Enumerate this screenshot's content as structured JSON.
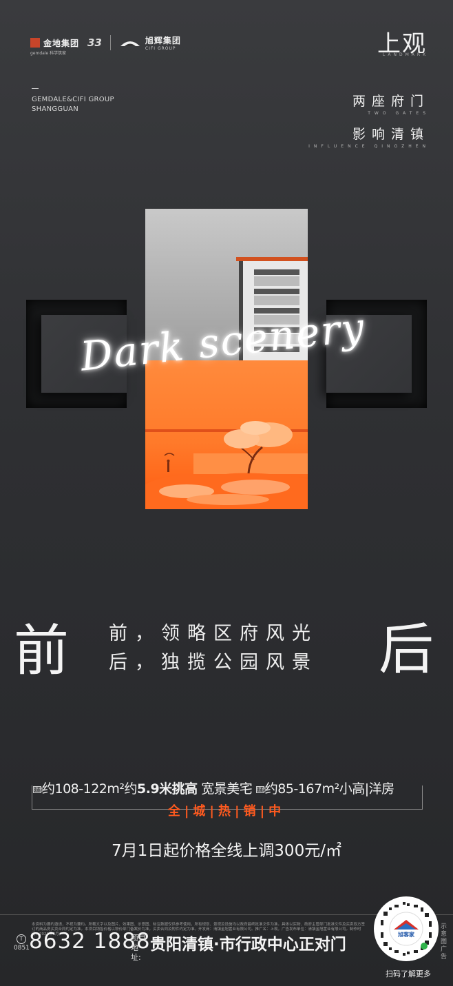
{
  "header": {
    "gemdale_logo": "金地集团",
    "gemdale_sub": "gemdale 科学筑家",
    "anniversary": "33",
    "cifi_logo": "旭辉集团",
    "cifi_sub": "CIFI GROUP",
    "brand_cn": "上观",
    "brand_en": "LANDMARK",
    "group_en_1": "GEMDALE&CIFI GROUP",
    "group_en_2": "SHANGGUAN",
    "slogan_1_cn": "两座府门",
    "slogan_1_en": "TWO GATES",
    "slogan_2_cn": "影响清镇",
    "slogan_2_en": "INFLUENCE QINGZHEN"
  },
  "hero": {
    "script_text": "Dark scenery"
  },
  "headline": {
    "left_char": "前",
    "right_char": "后",
    "line_1": "前，领略区府风光",
    "line_2": "后，独揽公园风景"
  },
  "promo": {
    "chip_label": "建面",
    "area_1": "约108-122m²约",
    "highlight": "5.9米挑高",
    "desc_1": "宽景美宅",
    "area_2": "约85-167m²小高|洋房",
    "hot_sale": "全|城|热|销|中",
    "price_note": "7月1日起价格全线上调300元/㎡"
  },
  "footer": {
    "phone_icon_label": "T",
    "area_code": "0851",
    "phone": "8632 1888",
    "addr_label": "项目地址:",
    "address": "贵阳清镇·市行政中心正对门",
    "fine_print": "本资料为要约邀请，不视为要约。所载文字以及图片、效果图、示意图、标注数据仅供参考使用，所有规划、景观及设施均以政府最终批准文件为准。具体以实物、政府主管部门批准文件及买卖双方签订的商品房买卖合同约定为准。本项目销售价格以物价部门备案价为准，买卖合同及附件约定为准。开发商：清镇金旭置业有限公司。推广名：上观。广告发布单位：清镇金旭置业有限公司。制作时间：2021年6月。",
    "qr_brand": "旭客家",
    "qr_caption": "扫码了解更多",
    "side_tag": "示意图 广告"
  },
  "colors": {
    "background": "#2f3033",
    "accent": "#ff5a1f",
    "text": "#f2f2f2"
  }
}
